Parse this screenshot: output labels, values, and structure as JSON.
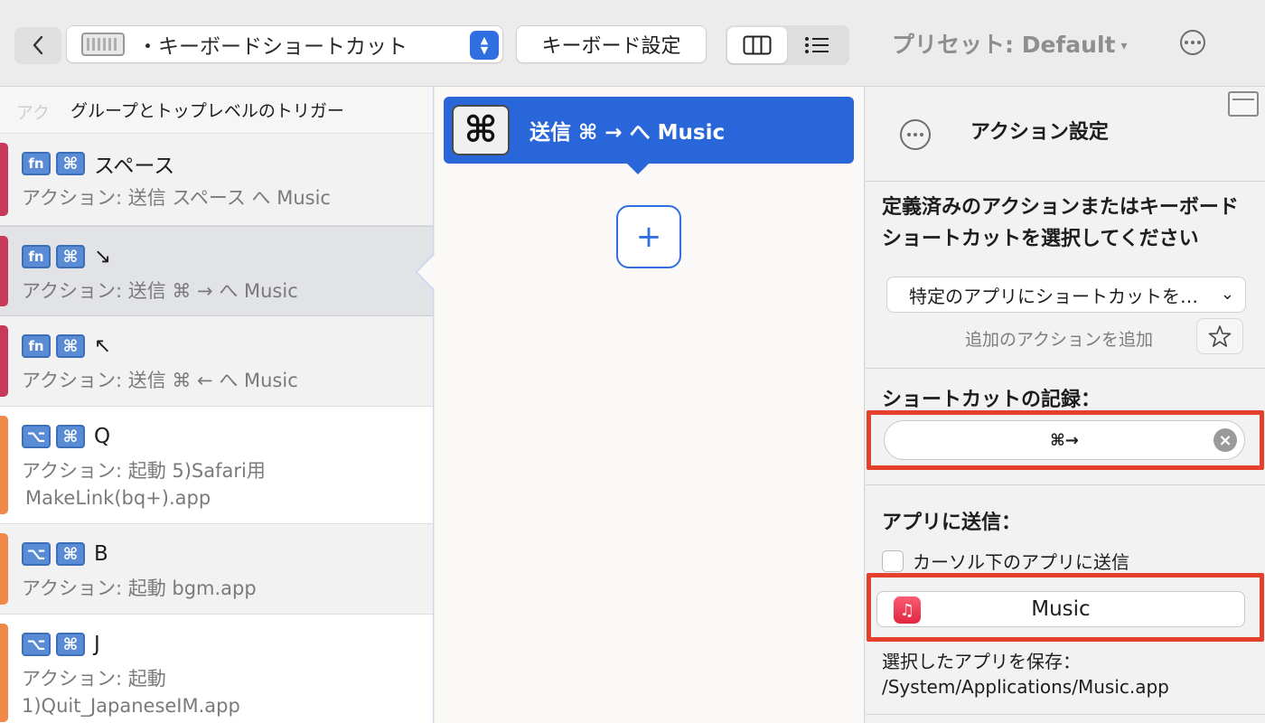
{
  "toolbar": {
    "context_label": "・キーボードショートカット",
    "keyboard_settings_label": "キーボード設定",
    "preset_label": "プリセット: Default",
    "preset_caret": "▾"
  },
  "left_panel": {
    "group_ghost": "アク",
    "group_header": "グループとトップレベルのトリガー",
    "triggers": [
      {
        "mod1": "fn",
        "mod2": "⌘",
        "key": "スペース",
        "action": "アクション: 送信  スペース へ Music",
        "bar_color": "#c8385a"
      },
      {
        "mod1": "fn",
        "mod2": "⌘",
        "key": "↘",
        "action": "アクション: 送信 ⌘ → へ Music",
        "bar_color": "#c8385a"
      },
      {
        "mod1": "fn",
        "mod2": "⌘",
        "key": "↖",
        "action": "アクション: 送信 ⌘ ← へ Music",
        "bar_color": "#c8385a"
      },
      {
        "mod1": "⌥",
        "mod2": "⌘",
        "key": "Q",
        "action_line1": "アクション: 起動 5)Safari用",
        "action_line2": "MakeLink(bq+).app",
        "bar_color": "#f0884a"
      },
      {
        "mod1": "⌥",
        "mod2": "⌘",
        "key": "B",
        "action": "アクション: 起動 bgm.app",
        "bar_color": "#f0884a"
      },
      {
        "mod1": "⌥",
        "mod2": "⌘",
        "key": "J",
        "action_line1": "アクション: 起動",
        "action_line2": "1)Quit_JapaneseIM.app",
        "bar_color": "#f0884a"
      }
    ]
  },
  "middle_panel": {
    "card_icon": "⌘",
    "card_label": "送信 ⌘ → へ Music",
    "add_label": "+"
  },
  "right_panel": {
    "settings_title": "アクション設定",
    "prompt": "定義済みのアクションまたはキーボードショートカットを選択してください",
    "action_select_value": "特定のアプリにショートカットを…",
    "add_action_label": "追加のアクションを追加",
    "record_title": "ショートカットの記録：",
    "shortcut_value": "⌘→",
    "send_title": "アプリに送信：",
    "checkbox_label": "カーソル下のアプリに送信",
    "app_name": "Music",
    "saved_path": "選択したアプリを保存：  /System/Applications/Music.app"
  },
  "colors": {
    "accent": "#2866d9",
    "highlight_red": "#e5402b",
    "fn_bar": "#c8385a",
    "alt_bar": "#f0884a"
  },
  "icons": [
    "back-chevron-icon",
    "keyboard-icon",
    "stepper-icon",
    "columns-icon",
    "list-icon",
    "more-icon",
    "window-icon",
    "command-icon",
    "star-icon",
    "clear-icon",
    "music-app-icon"
  ]
}
